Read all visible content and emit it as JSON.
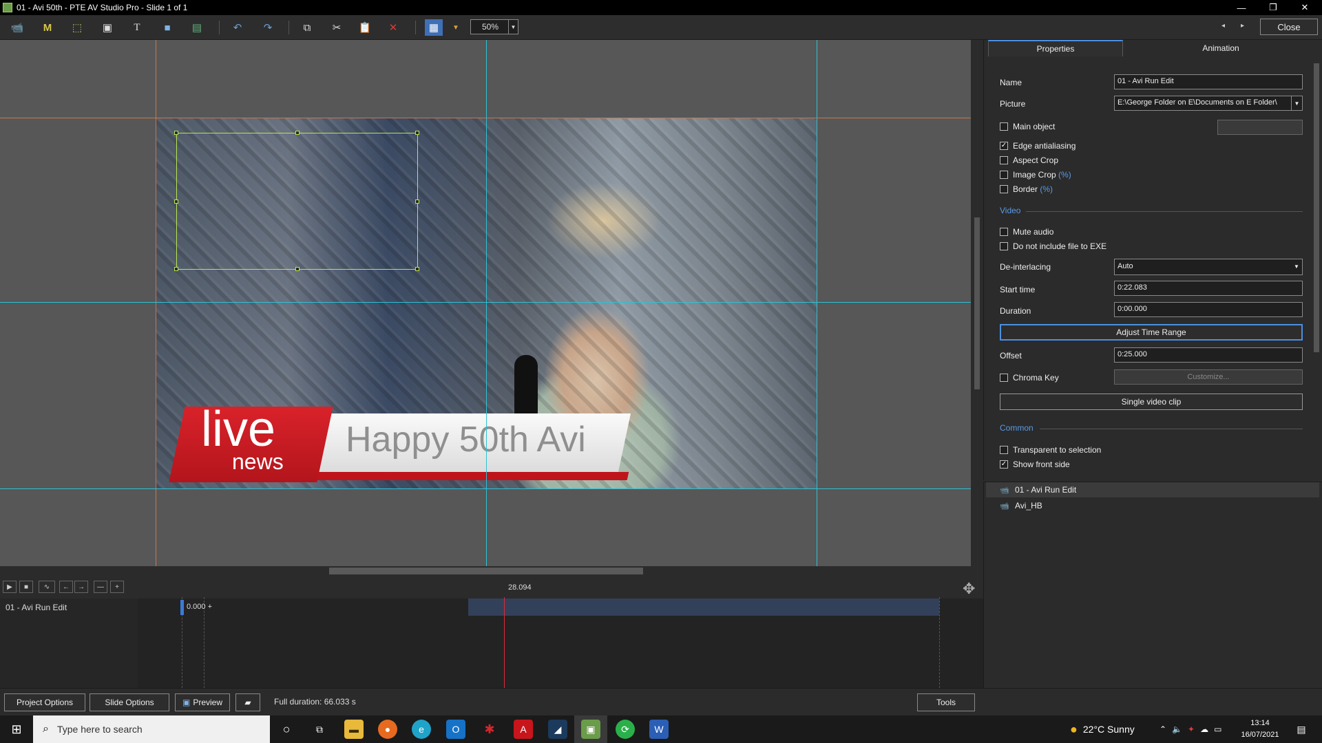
{
  "window": {
    "title": "01 - Avi 50th - PTE AV Studio Pro - Slide 1 of 1",
    "controls": {
      "minimize": "—",
      "maximize": "❐",
      "close": "✕"
    }
  },
  "toolbar": {
    "zoom": "50%",
    "close_label": "Close",
    "icons": [
      "video-object-icon",
      "mask-icon",
      "frame-icon",
      "image-icon",
      "text-icon",
      "rectangle-icon",
      "gradient-icon",
      "undo-icon",
      "redo-icon",
      "copy-icon",
      "cut-icon",
      "paste-icon",
      "delete-icon",
      "grid-icon",
      "chevron-down-icon"
    ],
    "nav_prev": "◂",
    "nav_next": "▸"
  },
  "stage": {
    "headline_live": "live",
    "headline_news": "news",
    "headline_text": "Happy 50th Avi",
    "colors": {
      "guide_orange": "#c8774a",
      "guide_cyan": "#2bc2d6",
      "selection": "#b8e64d"
    }
  },
  "timeline": {
    "current_time": "28.094",
    "track_name": "01 - Avi Run Edit",
    "start_value": "0.000 +",
    "buttons": [
      "▶",
      "■",
      "∿",
      "←",
      "→",
      "—",
      "+"
    ]
  },
  "bottom": {
    "project_options": "Project Options",
    "slide_options": "Slide Options",
    "preview": "Preview",
    "full_duration": "Full duration: 66.033 s",
    "tools": "Tools"
  },
  "properties": {
    "tabs": [
      "Properties",
      "Animation"
    ],
    "name_label": "Name",
    "name_value": "01 - Avi Run Edit",
    "picture_label": "Picture",
    "picture_value": "E:\\George Folder on E\\Documents on E Folder\\",
    "main_object": "Main object",
    "edge_antialiasing": "Edge antialiasing",
    "aspect_crop": "Aspect Crop",
    "image_crop": "Image Crop",
    "border": "Border",
    "pct": "(%)",
    "video_section": "Video",
    "mute_audio": "Mute audio",
    "no_exe": "Do not include file to EXE",
    "deinterlacing_label": "De-interlacing",
    "deinterlacing_value": "Auto",
    "start_time_label": "Start time",
    "start_time_value": "0:22.083",
    "duration_label": "Duration",
    "duration_value": "0:00.000",
    "adjust_time_range": "Adjust Time Range",
    "offset_label": "Offset",
    "offset_value": "0:25.000",
    "chroma_key": "Chroma Key",
    "customize": "Customize...",
    "single_video_clip": "Single video clip",
    "common_section": "Common",
    "transparent_to_selection": "Transparent to selection",
    "show_front_side": "Show front side",
    "checked": "✓"
  },
  "objects": [
    {
      "name": "01 - Avi Run Edit",
      "selected": true
    },
    {
      "name": "Avi_HB",
      "selected": false
    }
  ],
  "taskbar": {
    "search_placeholder": "Type here to search",
    "weather": "22°C  Sunny",
    "time": "13:14",
    "date": "16/07/2021"
  }
}
